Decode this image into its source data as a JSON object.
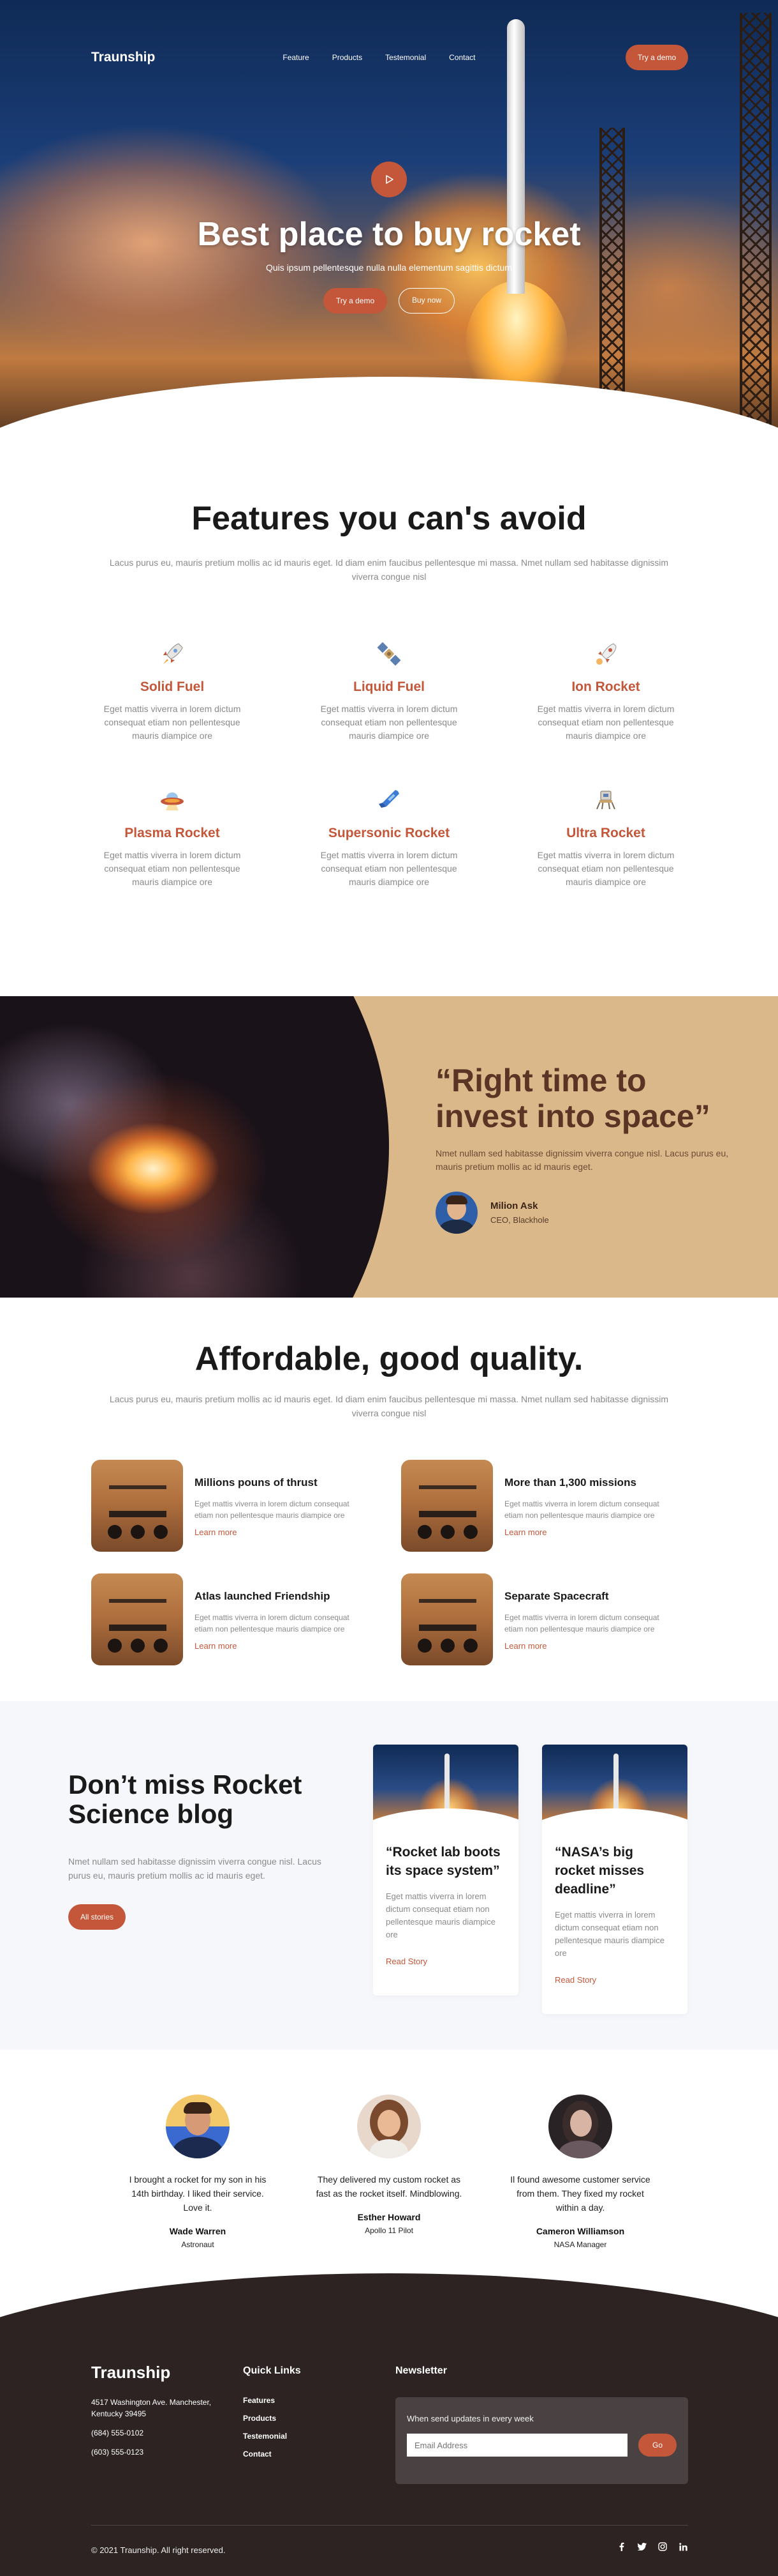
{
  "nav": {
    "logo": "Traunship",
    "items": [
      "Feature",
      "Products",
      "Testemonial",
      "Contact"
    ],
    "cta": "Try a demo"
  },
  "hero": {
    "title": "Best place to buy rocket",
    "subtitle": "Quis ipsum pellentesque nulla nulla elementum sagittis dictum",
    "primary_button": "Try a demo",
    "secondary_button": "Buy now"
  },
  "features": {
    "title": "Features you can's avoid",
    "subtitle": "Lacus purus eu, mauris pretium mollis ac id mauris eget. Id diam enim faucibus pellentesque mi massa. Nmet nullam sed habitasse dignissim viverra congue nisl",
    "items": [
      {
        "name": "Solid Fuel",
        "desc": "Eget mattis viverra in lorem dictum consequat etiam non pellentesque mauris diampice ore",
        "icon": "rocket-icon"
      },
      {
        "name": "Liquid Fuel",
        "desc": "Eget mattis viverra in lorem dictum consequat etiam non pellentesque mauris diampice ore",
        "icon": "satellite-icon"
      },
      {
        "name": "Ion Rocket",
        "desc": "Eget mattis viverra in lorem dictum consequat etiam non pellentesque mauris diampice ore",
        "icon": "rocket-launch-icon"
      },
      {
        "name": "Plasma Rocket",
        "desc": "Eget mattis viverra in lorem dictum consequat etiam non pellentesque mauris diampice ore",
        "icon": "ufo-icon"
      },
      {
        "name": "Supersonic Rocket",
        "desc": "Eget mattis viverra in lorem dictum consequat etiam non pellentesque mauris diampice ore",
        "icon": "missile-icon"
      },
      {
        "name": "Ultra Rocket",
        "desc": "Eget mattis viverra in lorem dictum consequat etiam non pellentesque mauris diampice ore",
        "icon": "lunar-lander-icon"
      }
    ]
  },
  "quote": {
    "title": "“Right time to invest into space”",
    "body": "Nmet nullam sed habitasse dignissim viverra congue nisl. Lacus purus eu, mauris pretium mollis ac id mauris eget.",
    "author_name": "Milion Ask",
    "author_role": "CEO, Blackhole"
  },
  "afford": {
    "title": "Affordable, good quality.",
    "subtitle": "Lacus purus eu, mauris pretium mollis ac id mauris eget. Id diam enim faucibus pellentesque mi massa. Nmet nullam sed habitasse dignissim viverra congue nisl",
    "items": [
      {
        "title": "Millions pouns of thrust",
        "desc": "Eget mattis viverra in lorem dictum consequat etiam non pellentesque mauris diampice ore",
        "link": "Learn more"
      },
      {
        "title": "More than 1,300 missions",
        "desc": "Eget mattis viverra in lorem dictum consequat etiam non pellentesque mauris diampice ore",
        "link": "Learn more"
      },
      {
        "title": "Atlas launched Friendship",
        "desc": "Eget mattis viverra in lorem dictum consequat etiam non pellentesque mauris diampice ore",
        "link": "Learn more"
      },
      {
        "title": "Separate Spacecraft",
        "desc": "Eget mattis viverra in lorem dictum consequat etiam non pellentesque mauris diampice ore",
        "link": "Learn more"
      }
    ]
  },
  "blog": {
    "title": "Don’t miss Rocket Science blog",
    "subtitle": "Nmet nullam sed habitasse dignissim viverra congue nisl. Lacus purus eu, mauris pretium mollis ac id mauris eget.",
    "button": "All stories",
    "cards": [
      {
        "title": "“Rocket lab boots its space system”",
        "desc": "Eget mattis viverra in lorem dictum consequat etiam non pellentesque mauris diampice ore",
        "link": "Read Story"
      },
      {
        "title": "“NASA’s big rocket misses deadline”",
        "desc": "Eget mattis viverra in lorem dictum consequat etiam non pellentesque mauris diampice ore",
        "link": "Read Story"
      }
    ]
  },
  "testimonials": [
    {
      "quote": "I brought a rocket for my son in his 14th birthday. I liked their service. Love it.",
      "name": "Wade Warren",
      "role": "Astronaut"
    },
    {
      "quote": "They delivered my custom rocket as fast as the rocket itself. Mindblowing.",
      "name": "Esther Howard",
      "role": "Apollo 11 Pilot"
    },
    {
      "quote": "Il found awesome customer service from them. They fixed my rocket within a day.",
      "name": "Cameron Williamson",
      "role": "NASA Manager"
    }
  ],
  "footer": {
    "logo": "Traunship",
    "address": "4517 Washington Ave. Manchester, Kentucky 39495",
    "phone1": "(684) 555-0102",
    "phone2": "(603) 555-0123",
    "quick_links_title": "Quick Links",
    "quick_links": [
      "Features",
      "Products",
      "Testemonial",
      "Contact"
    ],
    "newsletter_title": "Newsletter",
    "newsletter_label": "When send updates in every week",
    "email_placeholder": "Email Address",
    "go_button": "Go",
    "copyright": "© 2021 Traunship. All right reserved.",
    "socials": [
      "facebook-icon",
      "twitter-icon",
      "instagram-icon",
      "linkedin-icon"
    ]
  },
  "colors": {
    "accent": "#c4573a",
    "dark": "#2c2322",
    "sand": "#dbb88a"
  }
}
